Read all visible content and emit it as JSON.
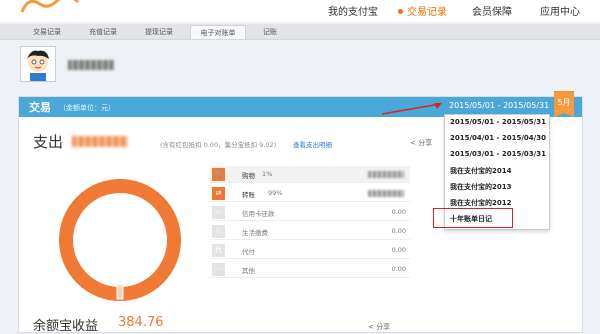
{
  "nav": {
    "items": [
      {
        "label": "我的支付宝",
        "active": false
      },
      {
        "label": "交易记录",
        "active": true
      },
      {
        "label": "会员保障",
        "active": false
      },
      {
        "label": "应用中心",
        "active": false
      }
    ]
  },
  "subnav": {
    "tabs": [
      "交易记录",
      "充值记录",
      "提现记录",
      "电子对账单",
      "记账"
    ]
  },
  "card": {
    "title": "交易",
    "subtitle": "（金额单位：元）",
    "date_range": "2015/05/01 - 2015/05/31",
    "month_badge": "5月",
    "expense_label": "支出",
    "expense_note": "(含有红包抵扣 0.00，集分宝抵扣 9.02)",
    "detail_link": "查看支出明细",
    "share_label": "分享"
  },
  "categories": [
    {
      "label": "购物",
      "pct": "1%",
      "amount": "",
      "highlight": true,
      "icon": "cart-icon",
      "glyph": "🛒"
    },
    {
      "label": "转账",
      "pct": "99%",
      "amount": "",
      "highlight": false,
      "icon": "transfer-icon",
      "glyph": "⇄"
    },
    {
      "label": "信用卡还款",
      "pct": "",
      "amount": "0.00",
      "highlight": false,
      "icon": "card-icon",
      "glyph": "▭"
    },
    {
      "label": "生活缴费",
      "pct": "",
      "amount": "0.00",
      "highlight": false,
      "icon": "bill-icon",
      "glyph": "⚇"
    },
    {
      "label": "代付",
      "pct": "",
      "amount": "0.00",
      "highlight": false,
      "icon": "pay-for-icon",
      "glyph": "代"
    },
    {
      "label": "其他",
      "pct": "",
      "amount": "0.00",
      "highlight": false,
      "icon": "more-icon",
      "glyph": "⋯"
    }
  ],
  "dropdown": {
    "items": [
      "2015/05/01 - 2015/05/31",
      "2015/04/01 - 2015/04/30",
      "2015/03/01 - 2015/03/31",
      "我在支付宝的2014",
      "我在支付宝的2013",
      "我在支付宝的2012",
      "十年账单日记"
    ]
  },
  "bottom": {
    "label": "余额宝收益",
    "amount": "384.76",
    "share": "分享"
  },
  "donut": {
    "segments": [
      {
        "label": "转账",
        "fraction": 0.99,
        "color": "#f07a35"
      },
      {
        "label": "购物",
        "fraction": 0.01,
        "color": "#f5b880"
      }
    ]
  },
  "colors": {
    "accent": "#ff6a00",
    "header_blue": "#4aa8d8",
    "highlight_red": "#e02020"
  }
}
